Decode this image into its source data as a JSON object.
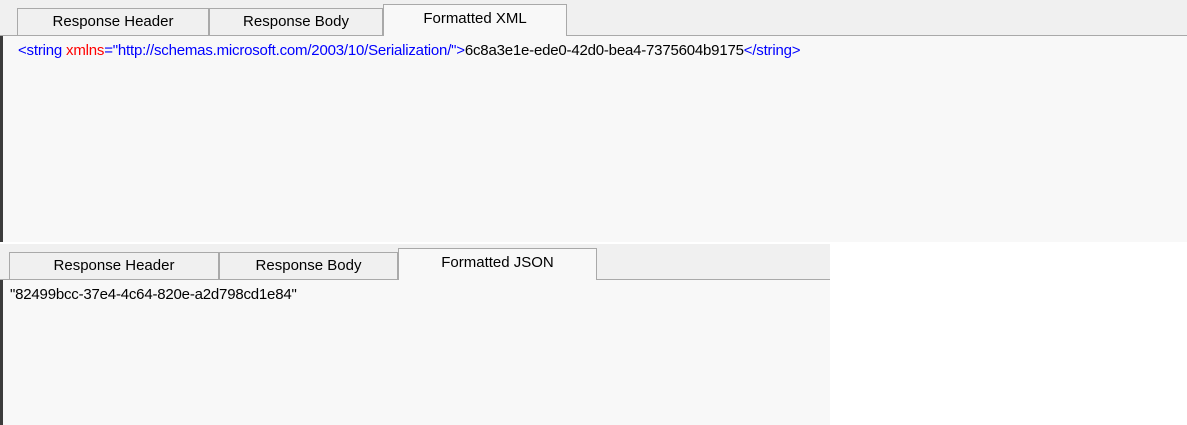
{
  "top_panel": {
    "tabs": [
      {
        "label": "Response Header",
        "active": false
      },
      {
        "label": "Response Body",
        "active": false
      },
      {
        "label": "Formatted XML",
        "active": true
      }
    ],
    "xml": {
      "open_bracket": "<string ",
      "attr_name": "xmlns",
      "attr_eq": "=",
      "attr_value": "\"http://schemas.microsoft.com/2003/10/Serialization/\"",
      "close_bracket": ">",
      "text": "6c8a3e1e-ede0-42d0-bea4-7375604b9175",
      "end_tag": "</string>"
    }
  },
  "bottom_panel": {
    "tabs": [
      {
        "label": "Response Header",
        "active": false
      },
      {
        "label": "Response Body",
        "active": false
      },
      {
        "label": "Formatted JSON",
        "active": true
      }
    ],
    "json_text": "\"82499bcc-37e4-4c64-820e-a2d798cd1e84\""
  },
  "colors": {
    "xml_tag": "#0000ff",
    "xml_attr": "#ff0000",
    "text": "#000000",
    "background": "#f8f8f8"
  }
}
